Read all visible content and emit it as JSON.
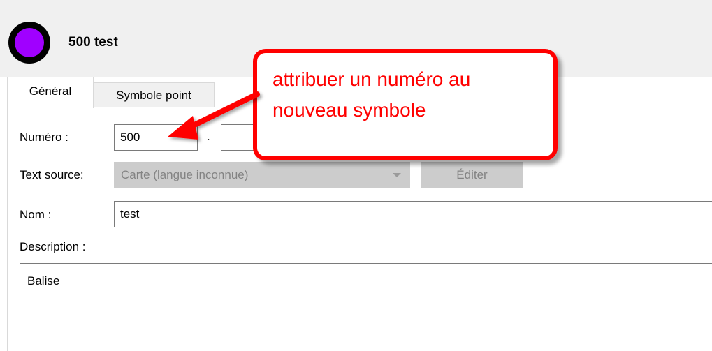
{
  "header": {
    "title": "500 test",
    "symbol_icon": "purple-circle-symbol-icon",
    "colors": {
      "symbol_fill": "#a000ff",
      "symbol_border": "#000000"
    }
  },
  "tabs": [
    {
      "label": "Général",
      "active": true
    },
    {
      "label": "Symbole point",
      "active": false
    }
  ],
  "form": {
    "number_label": "Numéro :",
    "number_value": "500",
    "number_separator": ".",
    "number_sub_value": "",
    "text_source_label": "Text source:",
    "text_source_value": "Carte (langue inconnue)",
    "edit_button_label": "Éditer",
    "name_label": "Nom :",
    "name_value": "test",
    "description_label": "Description :",
    "description_value": "Balise"
  },
  "annotation": {
    "text_line1": "attribuer un numéro au",
    "text_line2": "nouveau symbole",
    "color": "#ff0000"
  }
}
